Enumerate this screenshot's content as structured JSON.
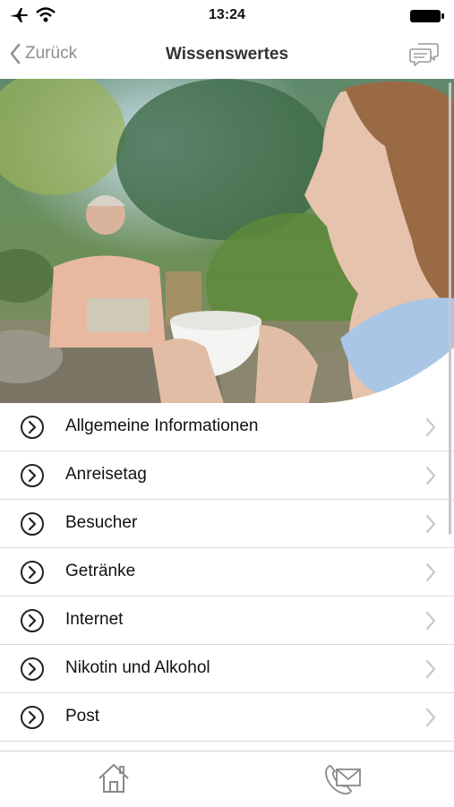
{
  "status": {
    "time": "13:24"
  },
  "nav": {
    "back_label": "Zurück",
    "title": "Wissenswertes"
  },
  "menu": {
    "items": [
      {
        "label": "Allgemeine Informationen"
      },
      {
        "label": "Anreisetag"
      },
      {
        "label": "Besucher"
      },
      {
        "label": "Getränke"
      },
      {
        "label": "Internet"
      },
      {
        "label": "Nikotin und Alkohol"
      },
      {
        "label": "Post"
      }
    ]
  },
  "tabbar": {
    "items": [
      "home-icon",
      "contact-icon"
    ]
  },
  "colors": {
    "accent_gray": "#8e8e93",
    "divider": "#d9d9d9"
  }
}
